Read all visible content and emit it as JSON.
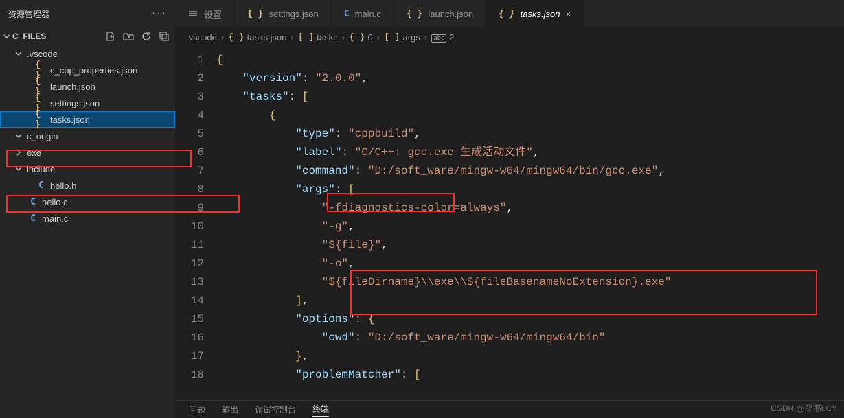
{
  "sidebar": {
    "title": "资源管理器",
    "section": "C_FILES",
    "tree": [
      {
        "kind": "folder",
        "label": ".vscode",
        "open": true,
        "indent": 1
      },
      {
        "kind": "json",
        "label": "c_cpp_properties.json",
        "indent": 2
      },
      {
        "kind": "json",
        "label": "launch.json",
        "indent": 2
      },
      {
        "kind": "json",
        "label": "settings.json",
        "indent": 2
      },
      {
        "kind": "json",
        "label": "tasks.json",
        "indent": 2,
        "selected": true
      },
      {
        "kind": "folder",
        "label": "c_origin",
        "open": true,
        "indent": 1
      },
      {
        "kind": "folder",
        "label": "exe",
        "open": false,
        "indent": 1
      },
      {
        "kind": "folder",
        "label": "include",
        "open": true,
        "indent": 1
      },
      {
        "kind": "c",
        "label": "hello.h",
        "indent": 2
      },
      {
        "kind": "c",
        "label": "hello.c",
        "indent": 1
      },
      {
        "kind": "c",
        "label": "main.c",
        "indent": 1
      }
    ]
  },
  "tabs": [
    {
      "label": "设置",
      "icon": "settings"
    },
    {
      "label": "settings.json",
      "icon": "json"
    },
    {
      "label": "main.c",
      "icon": "c"
    },
    {
      "label": "launch.json",
      "icon": "json"
    },
    {
      "label": "tasks.json",
      "icon": "json",
      "active": true,
      "italic": true,
      "closeable": true
    }
  ],
  "breadcrumb": [
    {
      "label": ".vscode"
    },
    {
      "icon": "{ }",
      "label": "tasks.json"
    },
    {
      "icon": "[ ]",
      "label": "tasks"
    },
    {
      "icon": "{ }",
      "label": "0"
    },
    {
      "icon": "[ ]",
      "label": "args"
    },
    {
      "icon": "abc",
      "label": "2"
    }
  ],
  "code": {
    "lines": [
      {
        "n": 1,
        "segs": [
          {
            "c": "tok-p",
            "t": "{"
          }
        ]
      },
      {
        "n": 2,
        "segs": [
          {
            "c": "",
            "t": "    "
          },
          {
            "c": "tok-k",
            "t": "\"version\""
          },
          {
            "c": "tok-w",
            "t": ": "
          },
          {
            "c": "tok-s",
            "t": "\"2.0.0\""
          },
          {
            "c": "tok-w",
            "t": ","
          }
        ]
      },
      {
        "n": 3,
        "segs": [
          {
            "c": "",
            "t": "    "
          },
          {
            "c": "tok-k",
            "t": "\"tasks\""
          },
          {
            "c": "tok-w",
            "t": ": "
          },
          {
            "c": "tok-p",
            "t": "["
          }
        ]
      },
      {
        "n": 4,
        "segs": [
          {
            "c": "",
            "t": "        "
          },
          {
            "c": "tok-p",
            "t": "{"
          }
        ]
      },
      {
        "n": 5,
        "segs": [
          {
            "c": "",
            "t": "            "
          },
          {
            "c": "tok-k",
            "t": "\"type\""
          },
          {
            "c": "tok-w",
            "t": ": "
          },
          {
            "c": "tok-s",
            "t": "\"cppbuild\""
          },
          {
            "c": "tok-w",
            "t": ","
          }
        ]
      },
      {
        "n": 6,
        "segs": [
          {
            "c": "",
            "t": "            "
          },
          {
            "c": "tok-k",
            "t": "\"label\""
          },
          {
            "c": "tok-w",
            "t": ": "
          },
          {
            "c": "tok-s",
            "t": "\"C/C++: gcc.exe 生成活动文件\""
          },
          {
            "c": "tok-w",
            "t": ","
          }
        ]
      },
      {
        "n": 7,
        "segs": [
          {
            "c": "",
            "t": "            "
          },
          {
            "c": "tok-k",
            "t": "\"command\""
          },
          {
            "c": "tok-w",
            "t": ": "
          },
          {
            "c": "tok-s",
            "t": "\"D:/soft_ware/mingw-w64/mingw64/bin/gcc.exe\""
          },
          {
            "c": "tok-w",
            "t": ","
          }
        ]
      },
      {
        "n": 8,
        "segs": [
          {
            "c": "",
            "t": "            "
          },
          {
            "c": "tok-k",
            "t": "\"args\""
          },
          {
            "c": "tok-w",
            "t": ": "
          },
          {
            "c": "tok-p",
            "t": "["
          }
        ]
      },
      {
        "n": 9,
        "segs": [
          {
            "c": "",
            "t": "                "
          },
          {
            "c": "tok-s",
            "t": "\"-fdiagnostics-color=always\""
          },
          {
            "c": "tok-w",
            "t": ","
          }
        ]
      },
      {
        "n": 10,
        "segs": [
          {
            "c": "",
            "t": "                "
          },
          {
            "c": "tok-s",
            "t": "\"-g\""
          },
          {
            "c": "tok-w",
            "t": ","
          }
        ]
      },
      {
        "n": 11,
        "segs": [
          {
            "c": "",
            "t": "                "
          },
          {
            "c": "tok-s",
            "t": "\"${file}\""
          },
          {
            "c": "tok-w",
            "t": ","
          }
        ]
      },
      {
        "n": 12,
        "segs": [
          {
            "c": "",
            "t": "                "
          },
          {
            "c": "tok-s",
            "t": "\"-o\""
          },
          {
            "c": "tok-w",
            "t": ","
          }
        ]
      },
      {
        "n": 13,
        "segs": [
          {
            "c": "",
            "t": "                "
          },
          {
            "c": "tok-s",
            "t": "\"${fileDirname}\\\\exe\\\\${fileBasenameNoExtension}.exe\""
          }
        ]
      },
      {
        "n": 14,
        "segs": [
          {
            "c": "",
            "t": "            "
          },
          {
            "c": "tok-p",
            "t": "]"
          },
          {
            "c": "tok-w",
            "t": ","
          }
        ]
      },
      {
        "n": 15,
        "segs": [
          {
            "c": "",
            "t": "            "
          },
          {
            "c": "tok-k",
            "t": "\"options\""
          },
          {
            "c": "tok-w",
            "t": ": "
          },
          {
            "c": "tok-p",
            "t": "{"
          }
        ]
      },
      {
        "n": 16,
        "segs": [
          {
            "c": "",
            "t": "                "
          },
          {
            "c": "tok-k",
            "t": "\"cwd\""
          },
          {
            "c": "tok-w",
            "t": ": "
          },
          {
            "c": "tok-s",
            "t": "\"D:/soft_ware/mingw-w64/mingw64/bin\""
          }
        ]
      },
      {
        "n": 17,
        "segs": [
          {
            "c": "",
            "t": "            "
          },
          {
            "c": "tok-p",
            "t": "}"
          },
          {
            "c": "tok-w",
            "t": ","
          }
        ]
      },
      {
        "n": 18,
        "segs": [
          {
            "c": "",
            "t": "            "
          },
          {
            "c": "tok-k",
            "t": "\"problemMatcher\""
          },
          {
            "c": "tok-w",
            "t": ": "
          },
          {
            "c": "tok-p",
            "t": "["
          }
        ]
      }
    ]
  },
  "panel": {
    "tabs": [
      "问题",
      "输出",
      "调试控制台",
      "终端"
    ],
    "active": 3
  },
  "watermark": "CSDN @耶耶LCY"
}
